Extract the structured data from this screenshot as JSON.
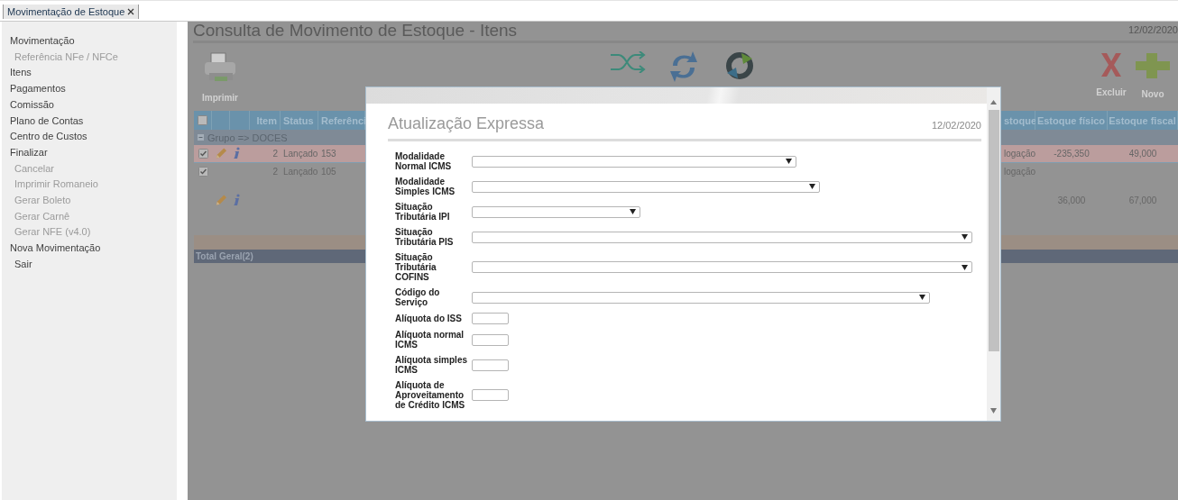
{
  "tabs": [
    {
      "label": "Movimentação de Estoque",
      "selected": true
    }
  ],
  "sidebar": {
    "items": [
      {
        "label": "Movimentação",
        "disabled": false,
        "children": [
          {
            "label": "Referência NFe / NFCe",
            "disabled": true
          }
        ]
      },
      {
        "label": "Itens",
        "disabled": false
      },
      {
        "label": "Pagamentos",
        "disabled": false
      },
      {
        "label": "Comissão",
        "disabled": false
      },
      {
        "label": "Plano de Contas",
        "disabled": false
      },
      {
        "label": "Centro de Custos",
        "disabled": false
      },
      {
        "label": "Finalizar",
        "disabled": false,
        "children": [
          {
            "label": "Cancelar",
            "disabled": true
          },
          {
            "label": "Imprimir Romaneio",
            "disabled": true
          },
          {
            "label": "Gerar Boleto",
            "disabled": true
          },
          {
            "label": "Gerar Carnê",
            "disabled": true
          },
          {
            "label": "Gerar NFE (v4.0)",
            "disabled": true
          }
        ]
      },
      {
        "label": "Nova Movimentação",
        "disabled": false,
        "children": [
          {
            "label": "Sair",
            "disabled": false
          }
        ]
      }
    ]
  },
  "page": {
    "title": "Consulta de Movimento de Estoque - Itens",
    "date": "12/02/2020"
  },
  "toolbar": [
    {
      "kind": "print",
      "label": "Imprimir"
    },
    {
      "kind": "shuffle"
    },
    {
      "kind": "refresh"
    },
    {
      "kind": "sync"
    },
    {
      "kind": "delete",
      "label": "Excluir"
    },
    {
      "kind": "add",
      "label": "Novo"
    }
  ],
  "table": {
    "select_all_checked": false,
    "columns": [
      "Item",
      "Status",
      "Referênci",
      "stoque",
      "Estoque físico",
      "Estoque fiscal"
    ],
    "group": {
      "label": "Grupo => DOCES",
      "expanded": true
    },
    "rows": [
      {
        "kind": "item",
        "checked": true,
        "highlighted": true,
        "actions": true,
        "cells": [
          "2",
          "Lançado",
          "153",
          "logação",
          "-235,350",
          "49,000"
        ]
      },
      {
        "kind": "item",
        "checked": true,
        "highlighted": false,
        "actions": false,
        "cells": [
          "2",
          "Lançado",
          "105",
          "logação",
          "",
          ""
        ]
      },
      {
        "kind": "detail",
        "actions": true,
        "cells": [
          "",
          "",
          "",
          "",
          "36,000",
          "67,000"
        ]
      }
    ],
    "total": "Total Geral(2)"
  },
  "modal": {
    "title": "Atualização Expressa",
    "date": "12/02/2020",
    "fields": [
      {
        "kind": "select",
        "label": "Modalidade Normal ICMS"
      },
      {
        "kind": "select",
        "label": "Modalidade Simples ICMS"
      },
      {
        "kind": "select",
        "label": "Situação Tributária IPI"
      },
      {
        "kind": "select",
        "label": "Situação Tributária PIS"
      },
      {
        "kind": "select",
        "label": "Situação Tributária COFINS"
      },
      {
        "kind": "select",
        "label": "Código do Serviço"
      },
      {
        "kind": "text",
        "label": "Alíquota do ISS"
      },
      {
        "kind": "text",
        "label": "Alíquota normal ICMS"
      },
      {
        "kind": "text",
        "label": "Alíquota simples ICMS"
      },
      {
        "kind": "text",
        "label": "Alíquota de Aproveitamento de Crédito ICMS"
      }
    ]
  }
}
